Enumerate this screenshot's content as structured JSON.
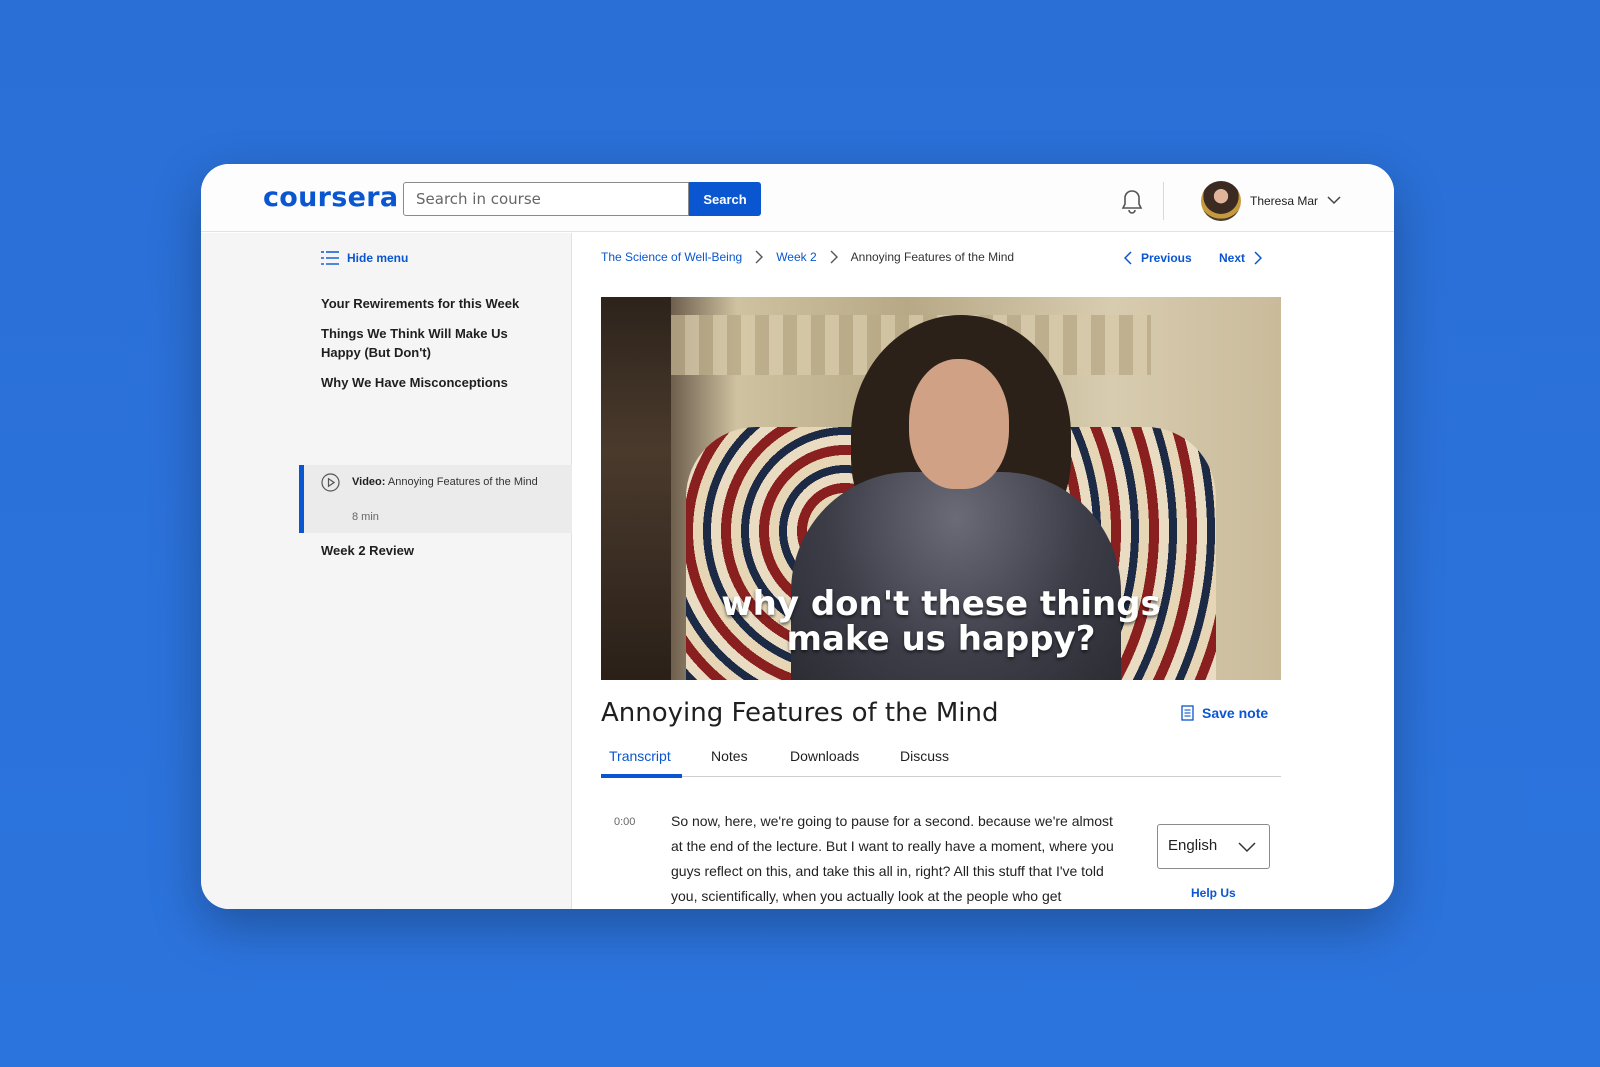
{
  "header": {
    "logo": "coursera",
    "search_placeholder": "Search in course",
    "search_button": "Search",
    "user_name": "Theresa Mar"
  },
  "sidebar": {
    "hide_menu": "Hide menu",
    "items": [
      {
        "label": "Your Rewirements for this Week"
      },
      {
        "label": "Things We Think Will Make Us Happy (But Don't)"
      },
      {
        "label": "Why We Have Misconceptions"
      },
      {
        "label": "Week 2 Review"
      }
    ],
    "active_item": {
      "type_label": "Video:",
      "title": "Annoying Features of the Mind",
      "duration": "8 min"
    }
  },
  "breadcrumb": {
    "course": "The Science of Well-Being",
    "week": "Week 2",
    "current": "Annoying Features of the Mind"
  },
  "nav": {
    "previous": "Previous",
    "next": "Next"
  },
  "video": {
    "subtitle_line1": "why don't these things",
    "subtitle_line2": "make us happy?"
  },
  "content": {
    "title": "Annoying Features of the Mind",
    "save_note": "Save note",
    "tabs": [
      "Transcript",
      "Notes",
      "Downloads",
      "Discuss"
    ],
    "active_tab": "Transcript"
  },
  "transcript": {
    "timestamp": "0:00",
    "text": "So now, here, we're going to pause for a second. because we're almost at the end of the lecture. But I want to really have a moment, where you guys reflect on this, and take this all in, right? All this stuff that I've told you, scientifically, when you actually look at the people who get",
    "language": "English",
    "help_us": "Help Us"
  },
  "colors": {
    "background": "#2b72db",
    "accent": "#0a56d0"
  }
}
